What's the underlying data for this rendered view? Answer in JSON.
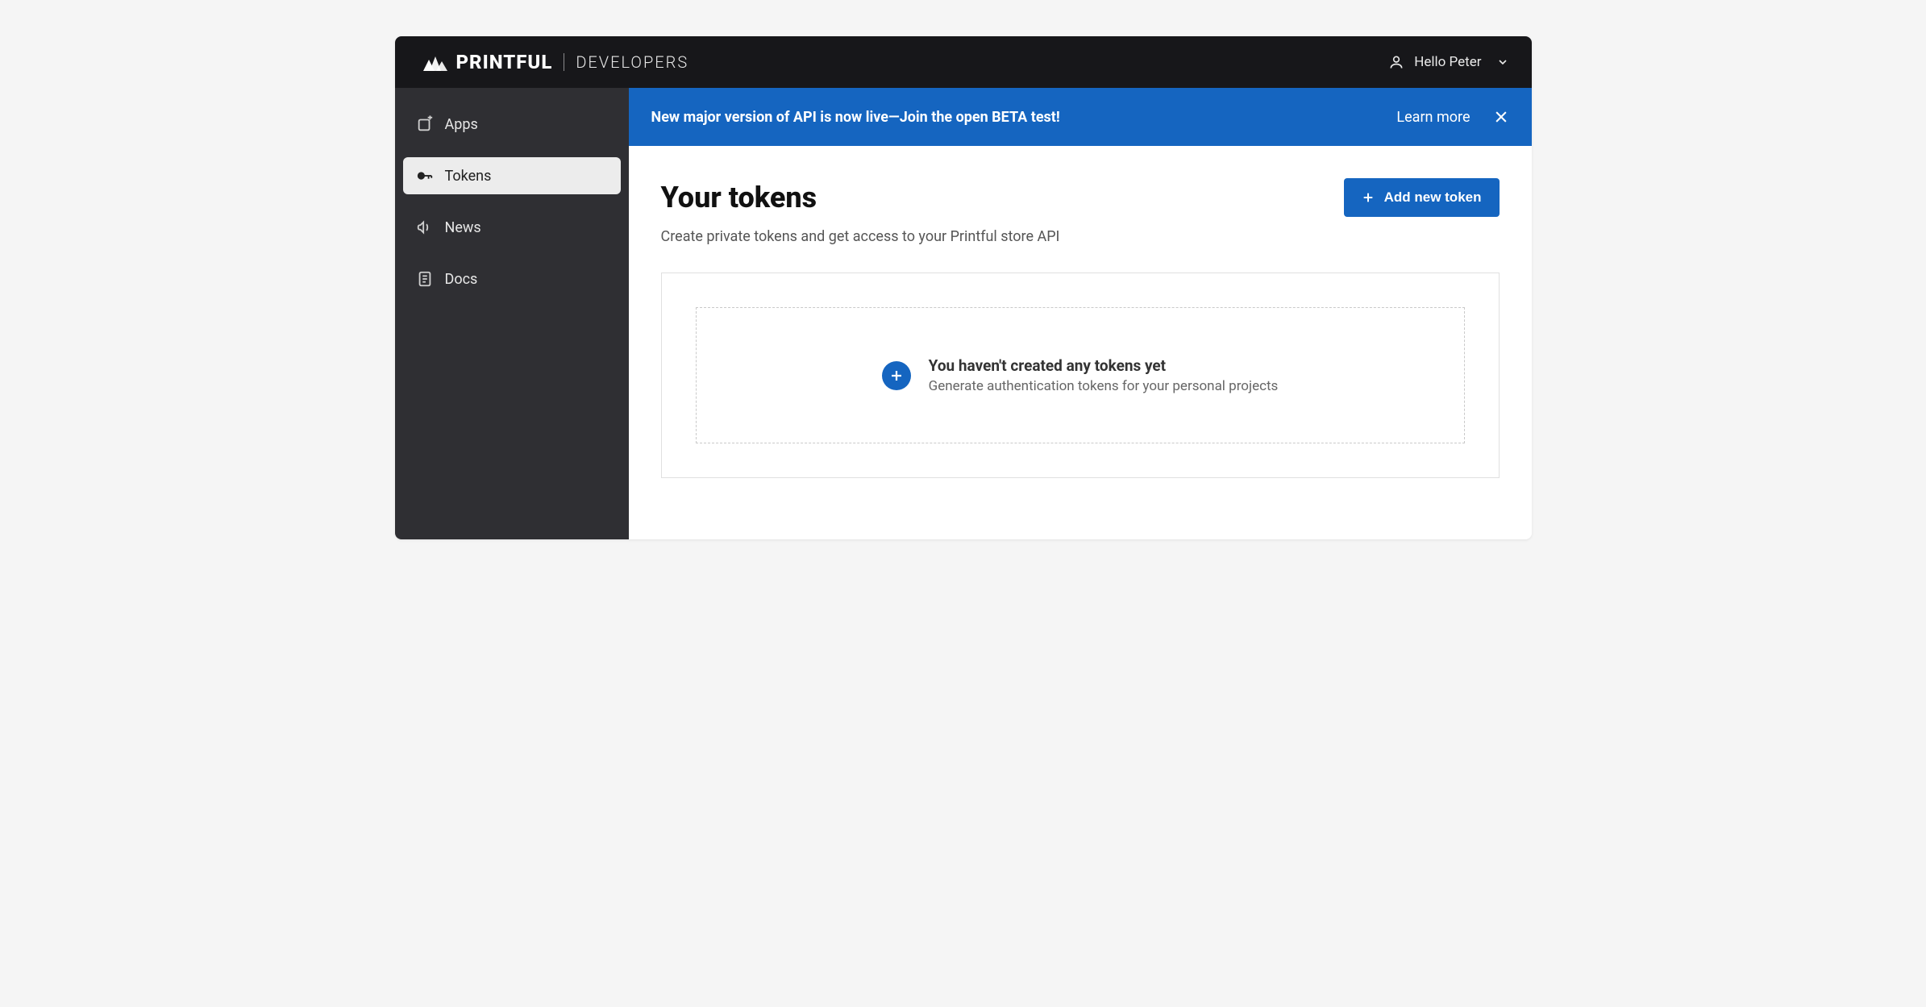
{
  "header": {
    "brand_name": "PRINTFUL",
    "brand_sub": "DEVELOPERS",
    "user_greeting": "Hello Peter"
  },
  "sidebar": {
    "items": [
      {
        "label": "Apps",
        "icon": "apps-icon",
        "active": false
      },
      {
        "label": "Tokens",
        "icon": "key-icon",
        "active": true
      },
      {
        "label": "News",
        "icon": "megaphone-icon",
        "active": false
      },
      {
        "label": "Docs",
        "icon": "document-icon",
        "active": false
      }
    ]
  },
  "banner": {
    "text": "New major version of API is now live—Join the open BETA test!",
    "link_label": "Learn more"
  },
  "page": {
    "title": "Your tokens",
    "subtitle": "Create private tokens and get access to your Printful store API",
    "add_button_label": "Add new token",
    "empty_title": "You haven't created any tokens yet",
    "empty_subtitle": "Generate authentication tokens for your personal projects"
  },
  "colors": {
    "header_bg": "#17171a",
    "sidebar_bg": "#2f2f33",
    "accent": "#1565c0"
  }
}
